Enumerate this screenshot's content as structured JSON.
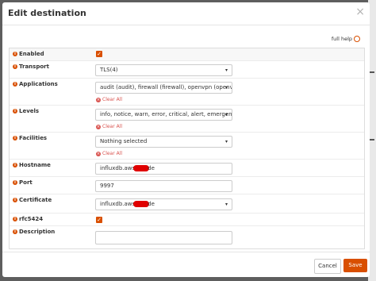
{
  "modal": {
    "title": "Edit destination",
    "close_glyph": "×",
    "full_help_label": "full help"
  },
  "fields": {
    "enabled": {
      "label": "Enabled",
      "checked": true
    },
    "transport": {
      "label": "Transport",
      "value": "TLS(4)"
    },
    "applications": {
      "label": "Applications",
      "value": "audit (audit), firewall (firewall), openvpn (openvpn)",
      "clear": "Clear All"
    },
    "levels": {
      "label": "Levels",
      "value": "info, notice, warn, error, critical, alert, emergency",
      "clear": "Clear All"
    },
    "facilities": {
      "label": "Facilities",
      "value": "Nothing selected",
      "clear": "Clear All"
    },
    "hostname": {
      "label": "Hostname",
      "value_prefix": "influxdb.aws",
      "value_suffix": "de"
    },
    "port": {
      "label": "Port",
      "value": "9997"
    },
    "certificate": {
      "label": "Certificate",
      "value_prefix": "influxdb.aws",
      "value_suffix": "de"
    },
    "rfc5424": {
      "label": "rfc5424",
      "checked": true
    },
    "description": {
      "label": "Description",
      "value": ""
    }
  },
  "icons": {
    "info": "i",
    "check": "✓",
    "caret": "▾",
    "clear": "×"
  },
  "footer": {
    "cancel_label": "Cancel",
    "save_label": "Save"
  },
  "colors": {
    "accent": "#d94f00",
    "danger": "#d9534f",
    "redaction": "#e00000"
  }
}
